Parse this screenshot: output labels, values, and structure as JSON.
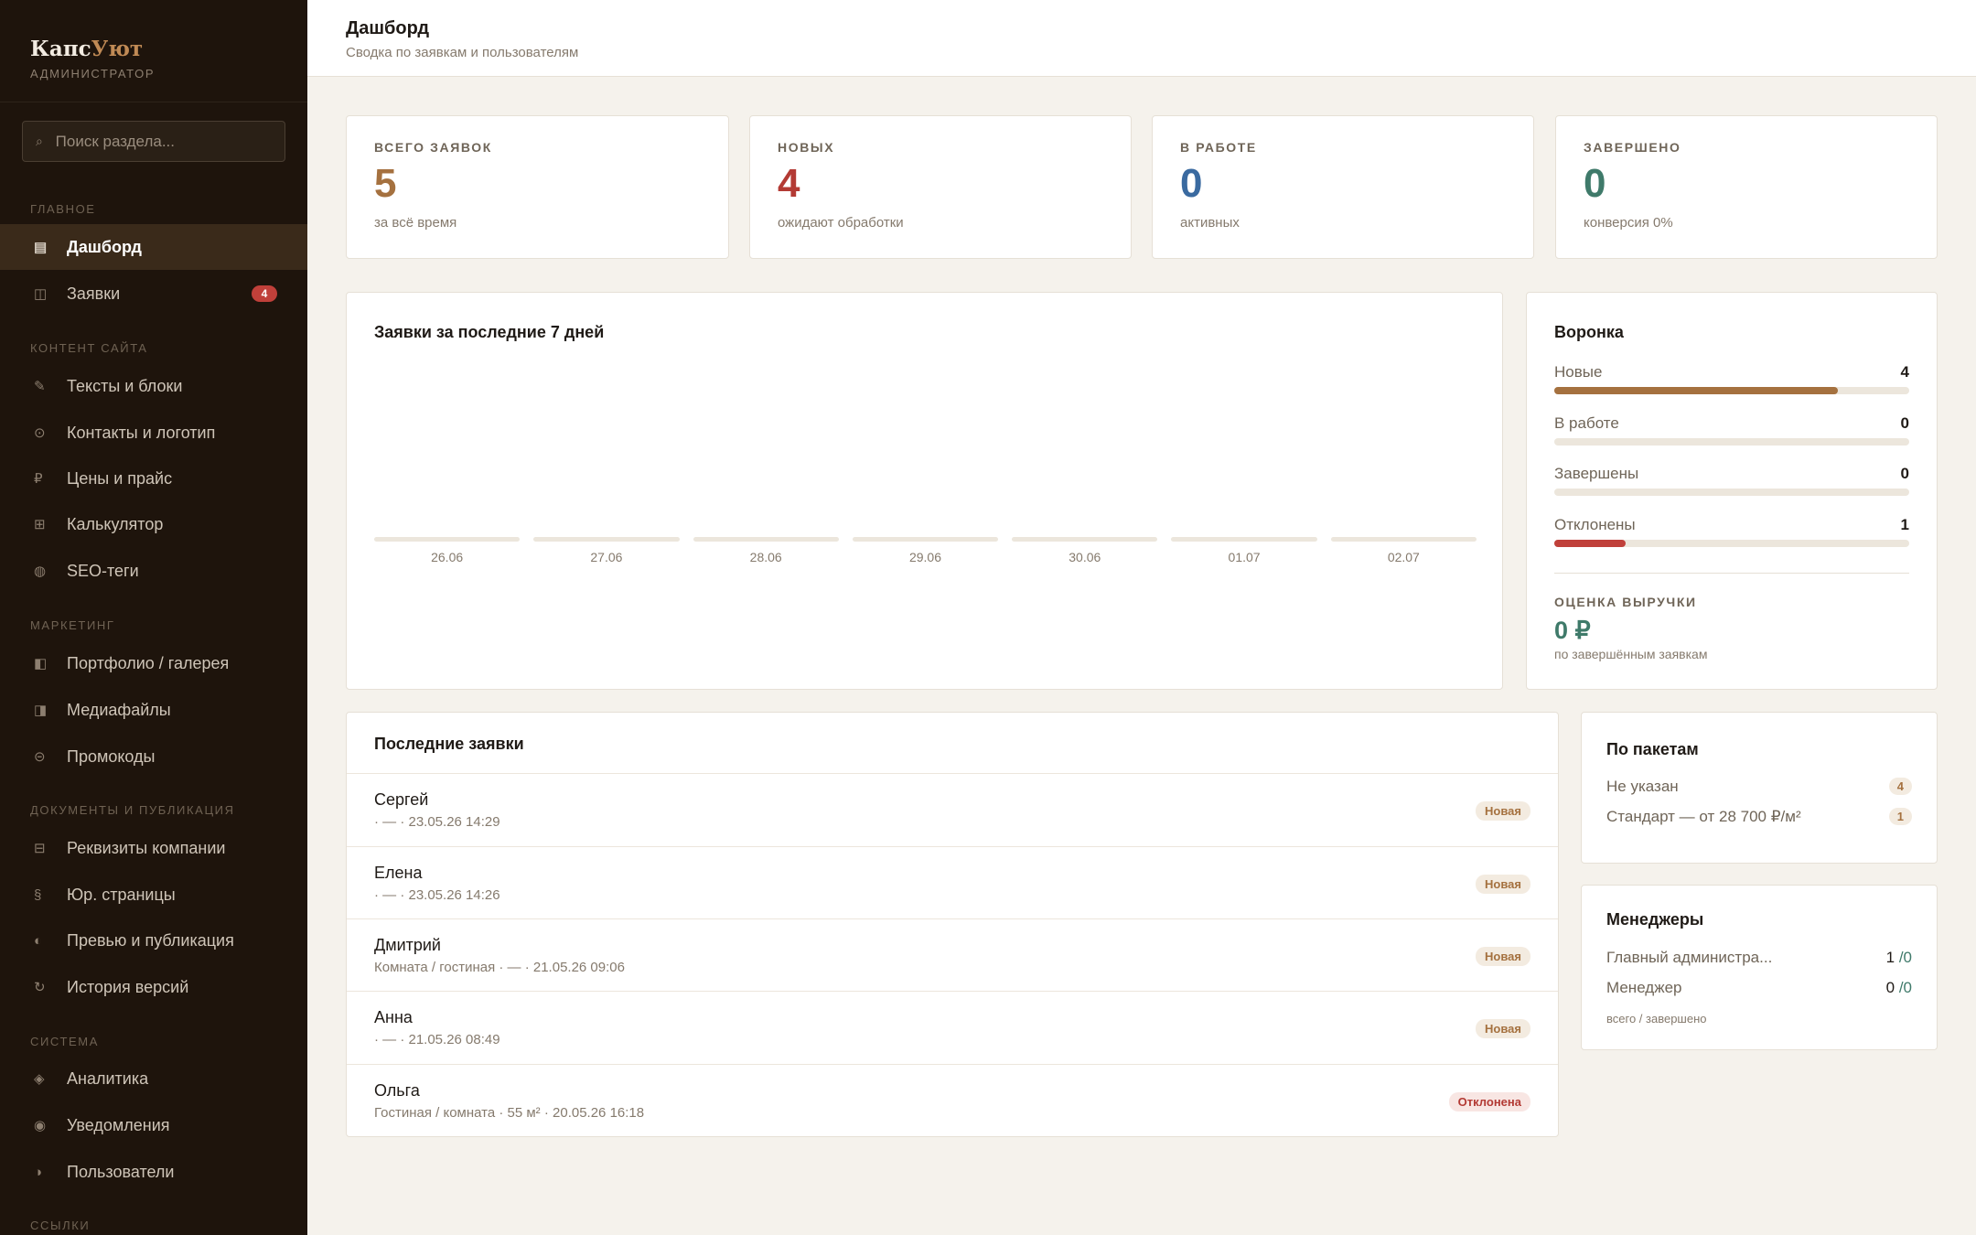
{
  "brand": {
    "name_a": "Капс",
    "name_b": "Уют",
    "role": "АДМИНИСТРАТОР"
  },
  "search": {
    "placeholder": "Поиск раздела...",
    "icon": "search-icon"
  },
  "sidebar": {
    "sections": [
      "ГЛАВНОЕ",
      "КОНТЕНТ САЙТА",
      "МАРКЕТИНГ",
      "ДОКУМЕНТЫ И ПУБЛИКАЦИЯ",
      "СИСТЕМА",
      "ССЫЛКИ"
    ],
    "items": [
      {
        "label": "Дашборд",
        "icon": "dashboard-icon",
        "glyph": "▤",
        "active": true
      },
      {
        "label": "Заявки",
        "icon": "requests-icon",
        "glyph": "◫",
        "badge": "4"
      },
      {
        "label": "Тексты и блоки",
        "icon": "pencil-icon",
        "glyph": "✎"
      },
      {
        "label": "Контакты и логотип",
        "icon": "contact-icon",
        "glyph": "⊙"
      },
      {
        "label": "Цены и прайс",
        "icon": "ruble-icon",
        "glyph": "₽"
      },
      {
        "label": "Калькулятор",
        "icon": "calculator-icon",
        "glyph": "⊞"
      },
      {
        "label": "SEO-теги",
        "icon": "seo-icon",
        "glyph": "◍"
      },
      {
        "label": "Портфолио / галерея",
        "icon": "gallery-icon",
        "glyph": "◧"
      },
      {
        "label": "Медиафайлы",
        "icon": "media-icon",
        "glyph": "◨"
      },
      {
        "label": "Промокоды",
        "icon": "promo-icon",
        "glyph": "⊝"
      },
      {
        "label": "Реквизиты компании",
        "icon": "company-icon",
        "glyph": "⊟"
      },
      {
        "label": "Юр. страницы",
        "icon": "legal-icon",
        "glyph": "§"
      },
      {
        "label": "Превью и публикация",
        "icon": "preview-icon",
        "glyph": "◐"
      },
      {
        "label": "История версий",
        "icon": "history-icon",
        "glyph": "↻"
      },
      {
        "label": "Аналитика",
        "icon": "analytics-icon",
        "glyph": "◈"
      },
      {
        "label": "Уведомления",
        "icon": "notifications-icon",
        "glyph": "◉"
      },
      {
        "label": "Пользователи",
        "icon": "users-icon",
        "glyph": "◑"
      }
    ]
  },
  "header": {
    "title": "Дашборд",
    "subtitle": "Сводка по заявкам и пользователям"
  },
  "stats": [
    {
      "label": "ВСЕГО ЗАЯВОК",
      "value": "5",
      "sub": "за всё время",
      "color": "#a5713f"
    },
    {
      "label": "НОВЫХ",
      "value": "4",
      "sub": "ожидают обработки",
      "color": "#b33a34"
    },
    {
      "label": "В РАБОТЕ",
      "value": "0",
      "sub": "активных",
      "color": "#3a6aa0"
    },
    {
      "label": "ЗАВЕРШЕНО",
      "value": "0",
      "sub": "конверсия 0%",
      "color": "#3f7a6a"
    }
  ],
  "chart_data": {
    "type": "bar",
    "title": "Заявки за последние 7 дней",
    "categories": [
      "26.06",
      "27.06",
      "28.06",
      "29.06",
      "30.06",
      "01.07",
      "02.07"
    ],
    "values": [
      0,
      0,
      0,
      0,
      0,
      0,
      0
    ]
  },
  "funnel": {
    "title": "Воронка",
    "rows": [
      {
        "label": "Новые",
        "value": "4",
        "fraction": 0.8,
        "color": "#a5713f"
      },
      {
        "label": "В работе",
        "value": "0",
        "fraction": 0,
        "color": "#a5713f"
      },
      {
        "label": "Завершены",
        "value": "0",
        "fraction": 0,
        "color": "#3f7a6a"
      },
      {
        "label": "Отклонены",
        "value": "1",
        "fraction": 0.2,
        "color": "#c0403a"
      }
    ],
    "revenue_label": "ОЦЕНКА ВЫРУЧКИ",
    "revenue_value": "0 ₽",
    "revenue_sub": "по завершённым заявкам"
  },
  "recent": {
    "title": "Последние заявки",
    "rows": [
      {
        "name": "Сергей",
        "meta": "· — · 23.05.26 14:29",
        "status": "Новая",
        "kind": "new"
      },
      {
        "name": "Елена",
        "meta": "· — · 23.05.26 14:26",
        "status": "Новая",
        "kind": "new"
      },
      {
        "name": "Дмитрий",
        "meta": "Комната / гостиная · — · 21.05.26 09:06",
        "status": "Новая",
        "kind": "new"
      },
      {
        "name": "Анна",
        "meta": "· — · 21.05.26 08:49",
        "status": "Новая",
        "kind": "new"
      },
      {
        "name": "Ольга",
        "meta": "Гостиная / комната · 55 м² · 20.05.26 16:18",
        "status": "Отклонена",
        "kind": "rejected"
      }
    ]
  },
  "packages": {
    "title": "По пакетам",
    "rows": [
      {
        "label": "Не указан",
        "count": "4"
      },
      {
        "label": "Стандарт — от 28 700 ₽/м²",
        "count": "1"
      }
    ]
  },
  "managers": {
    "title": "Менеджеры",
    "rows": [
      {
        "label": "Главный администра...",
        "total": "1",
        "done": "/0"
      },
      {
        "label": "Менеджер",
        "total": "0",
        "done": "/0"
      }
    ],
    "footnote": "всего / завершено"
  }
}
